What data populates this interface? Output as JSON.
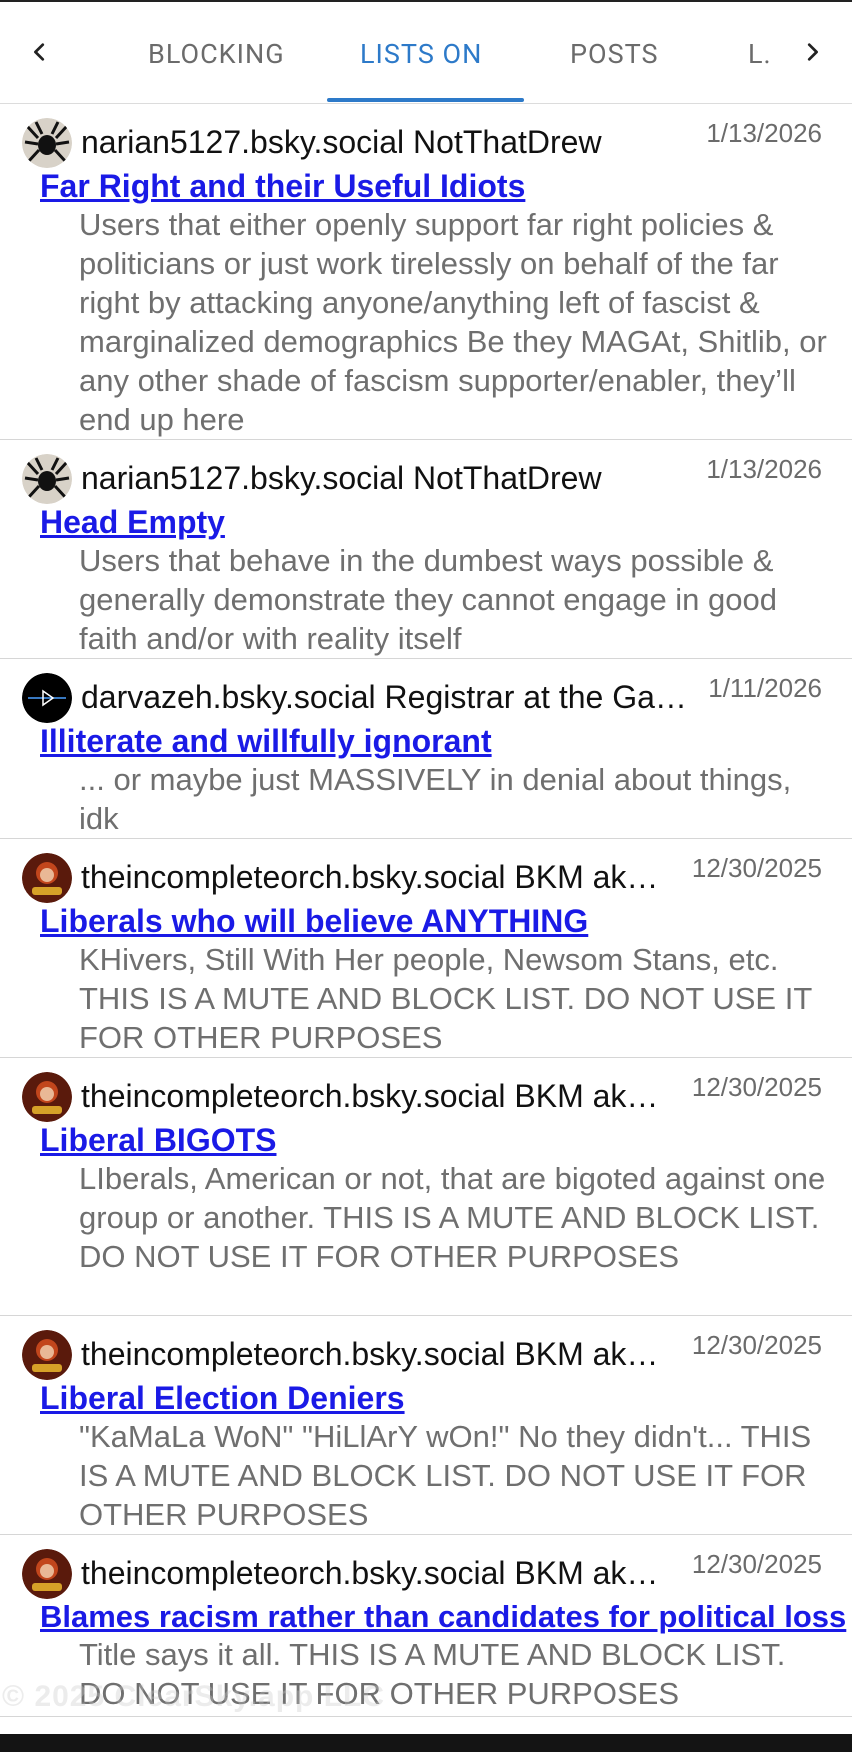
{
  "tabs": {
    "items": [
      "BLOCKING",
      "LISTS ON",
      "POSTS",
      "L..."
    ],
    "active_index": 1
  },
  "items": [
    {
      "owner": "narian5127.bsky.social NotThatDrew",
      "date": "1/13/2026",
      "title": "Far Right and their Useful Idiots",
      "description": "Users that either openly support far right policies & politicians or just work tirelessly on behalf of the far right by attacking anyone/anything left of fascist & marginalized demographics Be they MAGAt, Shitlib, or any other shade of fascism supporter/enabler, they’ll end up here"
    },
    {
      "owner": "narian5127.bsky.social NotThatDrew",
      "date": "1/13/2026",
      "title": "Head Empty",
      "description": "Users that behave in the dumbest ways possible & generally demonstrate they cannot engage in good faith and/or with reality itself"
    },
    {
      "owner": "darvazeh.bsky.social Registrar at the Ga…",
      "date": "1/11/2026",
      "title": "Illiterate and willfully ignorant",
      "description": "... or maybe just MASSIVELY in denial about things, idk"
    },
    {
      "owner": "theincompleteorch.bsky.social BKM ak…",
      "date": "12/30/2025",
      "title": "Liberals who will believe ANYTHING",
      "description": "KHivers, Still With Her people, Newsom Stans, etc. THIS IS A MUTE AND BLOCK LIST. DO NOT USE IT FOR OTHER PURPOSES"
    },
    {
      "owner": "theincompleteorch.bsky.social BKM ak…",
      "date": "12/30/2025",
      "title": "Liberal BIGOTS",
      "description": "LIberals, American or not, that are bigoted against one group or another. THIS IS A MUTE AND BLOCK LIST. DO NOT USE IT FOR OTHER PURPOSES"
    },
    {
      "owner": "theincompleteorch.bsky.social BKM ak…",
      "date": "12/30/2025",
      "title": "Liberal Election Deniers",
      "description": "\"KaMaLa WoN\" \"HiLlArY wOn!\" No they didn't... THIS IS A MUTE AND BLOCK LIST. DO NOT USE IT FOR OTHER PURPOSES"
    },
    {
      "owner": "theincompleteorch.bsky.social BKM ak…",
      "date": "12/30/2025",
      "title": "Blames racism rather than candidates for political loss",
      "description": "Title says it all. THIS IS A MUTE AND BLOCK LIST. DO NOT USE IT FOR OTHER PURPOSES"
    }
  ],
  "watermark": "© 2025 ClearSky.app LLC",
  "colors": {
    "accent": "#2d7ac9",
    "link": "#1a1ae6",
    "muted_text": "#6f6f6f"
  }
}
